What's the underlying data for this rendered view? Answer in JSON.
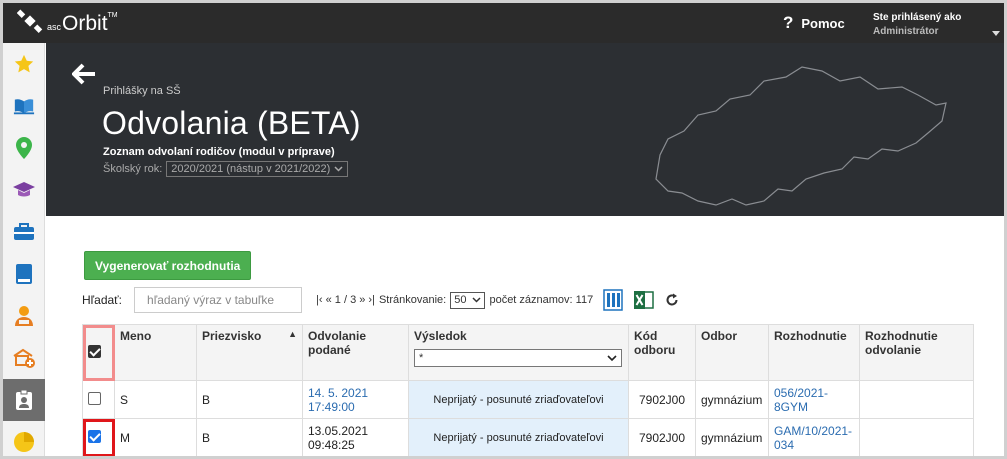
{
  "app": {
    "logo_small": "asc",
    "logo_main": "Orbit",
    "logo_tm": "TM",
    "help_label": "Pomoc",
    "user_line1": "Ste prihlásený ako",
    "user_line2": "Administrátor"
  },
  "sidebar": {
    "items": [
      {
        "icon": "star-icon"
      },
      {
        "icon": "book-open-icon"
      },
      {
        "icon": "location-pin-icon"
      },
      {
        "icon": "graduation-cap-icon"
      },
      {
        "icon": "briefcase-icon"
      },
      {
        "icon": "book-icon"
      },
      {
        "icon": "teacher-icon"
      },
      {
        "icon": "school-add-icon"
      },
      {
        "icon": "clipboard-user-icon",
        "active": true
      },
      {
        "icon": "pie-chart-icon"
      }
    ]
  },
  "hero": {
    "breadcrumb": "Prihlášky na SŠ",
    "title": "Odvolania (BETA)",
    "subtitle": "Zoznam odvolaní rodičov (modul v príprave)",
    "year_label": "Školský rok:",
    "year_value": "2020/2021 (nástup v 2021/2022)"
  },
  "toolbar": {
    "generate_button": "Vygenerovať rozhodnutia",
    "search_label": "Hľadať:",
    "search_placeholder": "hľadaný výraz v tabuľke",
    "pager_text": "|‹ « 1 / 3 » ›|",
    "paging_label": "Stránkovanie:",
    "per_page": "50",
    "records_label": "počet záznamov: 117"
  },
  "table": {
    "headers": {
      "meno": "Meno",
      "priezvisko": "Priezvisko",
      "odvolanie": "Odvolanie podané",
      "vysledok": "Výsledok",
      "kod": "Kód odboru",
      "odbor": "Odbor",
      "rozhodnutie": "Rozhodnutie",
      "rozhodnutie_odvolanie": "Rozhodnutie odvolanie"
    },
    "vysledok_filter": "*",
    "rows": [
      {
        "checked": false,
        "meno": "S",
        "priezvisko": "B",
        "odvolanie_1": "14. 5. 2021",
        "odvolanie_2": "17:49:00",
        "vysledok": "Neprijatý - posunuté zriaďovateľovi",
        "kod": "7902J00",
        "odbor": "gymnázium",
        "rozhodnutie_1": "056/2021-",
        "rozhodnutie_2": "8GYM"
      },
      {
        "checked": true,
        "meno": "M",
        "priezvisko": "B",
        "odvolanie_1": "13.05.2021",
        "odvolanie_2": "09:48:25",
        "vysledok": "Neprijatý - posunuté zriaďovateľovi",
        "kod": "7902J00",
        "odbor": "gymnázium",
        "rozhodnutie_1": "GAM/10/2021-",
        "rozhodnutie_2": "034"
      }
    ]
  },
  "colors": {
    "header_bg": "#2b2b2b",
    "hero_bg": "#2c2f33",
    "accent_green": "#4caf50",
    "link_blue": "#2b6cb0",
    "highlight_red": "#e0161a",
    "highlight_pink": "#f28c8c"
  }
}
